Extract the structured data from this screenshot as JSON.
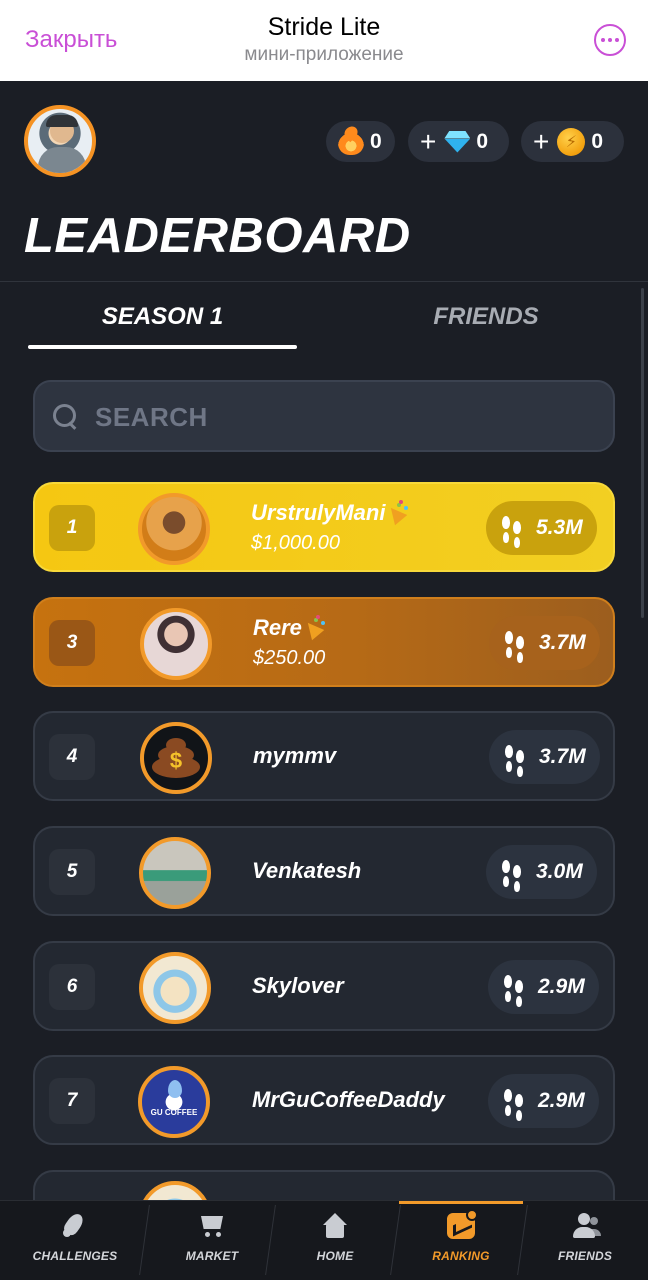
{
  "telegram_header": {
    "close_label": "Закрыть",
    "app_title": "Stride Lite",
    "subtitle": "мини-приложение"
  },
  "currencies": [
    {
      "icon": "fire-icon",
      "value": "0",
      "has_plus": false
    },
    {
      "icon": "diamond-icon",
      "value": "0",
      "has_plus": true
    },
    {
      "icon": "coin-icon",
      "value": "0",
      "has_plus": true
    }
  ],
  "currency_plus_label": "+",
  "page_title": "LEADERBOARD",
  "tabs": {
    "season": "SEASON 1",
    "friends": "FRIENDS",
    "active": "season"
  },
  "search": {
    "placeholder": "SEARCH",
    "value": ""
  },
  "leaderboard": [
    {
      "rank": "1",
      "name": "UrstrulyMani",
      "prize": "$1,000.00",
      "steps": "5.3M",
      "style": "gold",
      "badge": "party-popper-icon"
    },
    {
      "rank": "3",
      "name": "Rere",
      "prize": "$250.00",
      "steps": "3.7M",
      "style": "bronze",
      "badge": "party-popper-icon"
    },
    {
      "rank": "4",
      "name": "mymmv",
      "prize": "",
      "steps": "3.7M",
      "style": "default"
    },
    {
      "rank": "5",
      "name": "Venkatesh",
      "prize": "",
      "steps": "3.0M",
      "style": "default"
    },
    {
      "rank": "6",
      "name": "Skylover",
      "prize": "",
      "steps": "2.9M",
      "style": "default"
    },
    {
      "rank": "7",
      "name": "MrGuCoffeeDaddy",
      "prize": "",
      "steps": "2.9M",
      "style": "default"
    }
  ],
  "avatar_texts": {
    "poo_symbol": "$",
    "gu_coffee": "GU COFFEE"
  },
  "bottom_nav": [
    {
      "label": "CHALLENGES",
      "icon": "rocket-icon"
    },
    {
      "label": "MARKET",
      "icon": "cart-icon"
    },
    {
      "label": "HOME",
      "icon": "home-icon"
    },
    {
      "label": "RANKING",
      "icon": "ranking-chart-icon",
      "active": true
    },
    {
      "label": "FRIENDS",
      "icon": "friends-icon"
    }
  ],
  "colors": {
    "accent": "#f29a2a",
    "telegram_link": "#c94fd6",
    "gold_row": "#f5c712",
    "bronze_row": "#c6720f",
    "background": "#1b1e25"
  }
}
